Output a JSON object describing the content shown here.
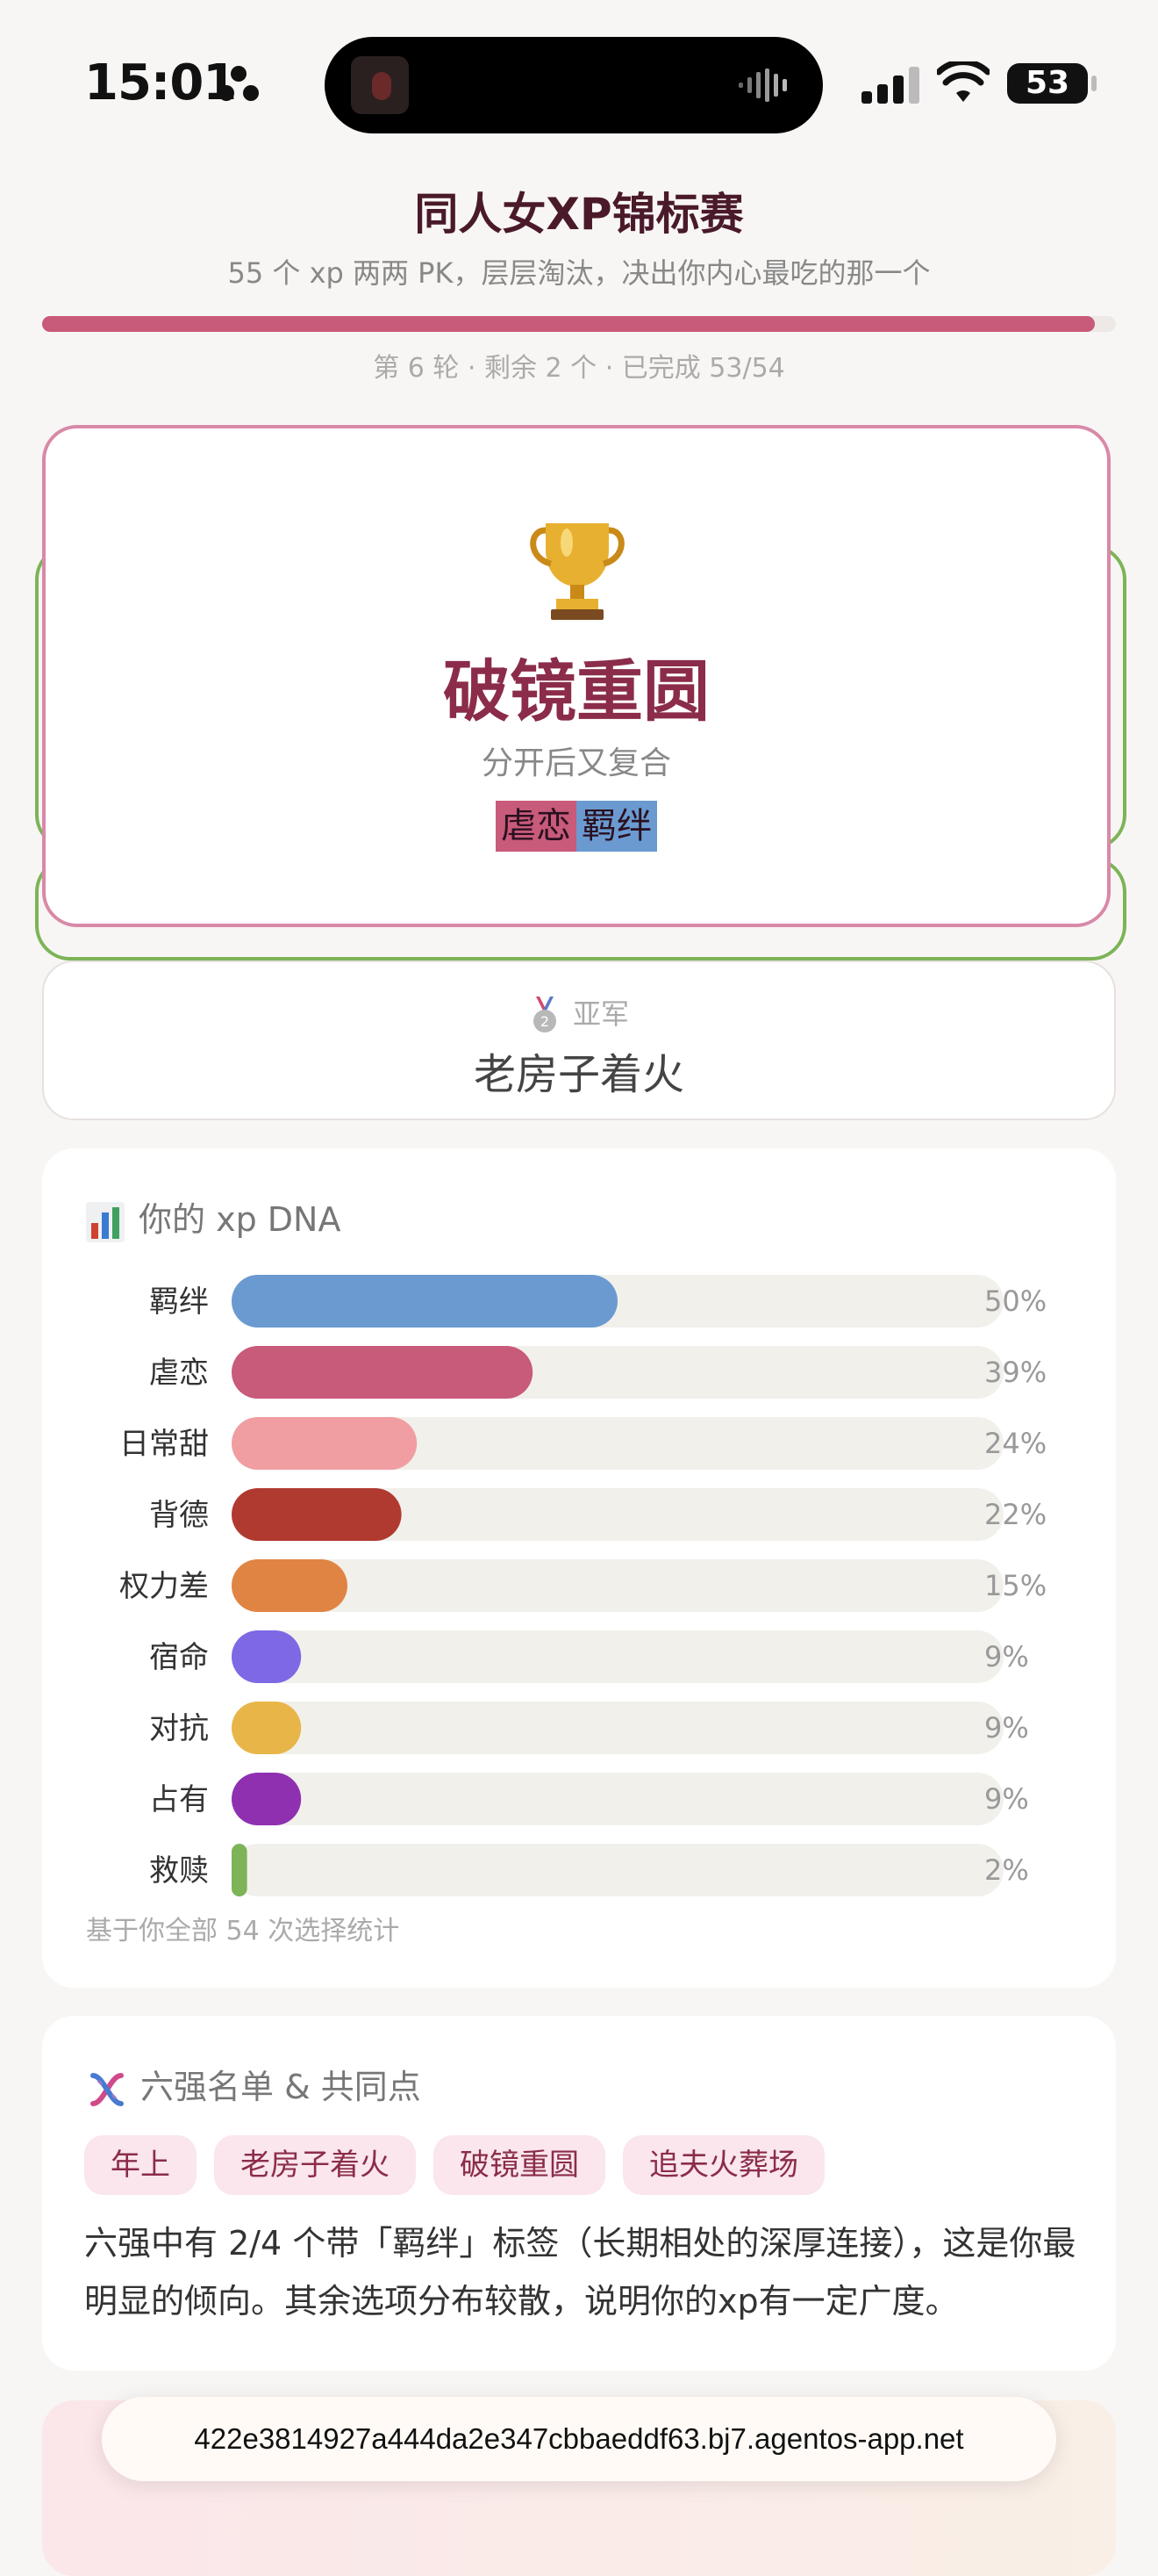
{
  "status_bar": {
    "time": "15:01",
    "battery": "53"
  },
  "header": {
    "title": "同人女XP锦标赛",
    "subtitle": "55 个 xp 两两 PK，层层淘汰，决出你内心最吃的那一个",
    "progress": 0.98,
    "round_info": "第 6 轮 · 剩余 2 个 · 已完成 53/54"
  },
  "champion": {
    "icon": "trophy-icon",
    "name": "破镜重圆",
    "description": "分开后又复合",
    "tags": [
      {
        "label": "虐恋",
        "color": "#c85a7a"
      },
      {
        "label": "羁绊",
        "color": "#6a9ad0"
      }
    ]
  },
  "runner_up": {
    "icon": "silver-medal-icon",
    "label": "亚军",
    "name": "老房子着火"
  },
  "dna": {
    "heading": "你的 xp DNA",
    "footnote": "基于你全部 54 次选择统计",
    "chart_data": {
      "type": "bar",
      "orientation": "horizontal",
      "categories": [
        "羁绊",
        "虐恋",
        "日常甜",
        "背德",
        "权力差",
        "宿命",
        "对抗",
        "占有",
        "救赎"
      ],
      "values": [
        50,
        39,
        24,
        22,
        15,
        9,
        9,
        9,
        2
      ],
      "value_labels": [
        "50%",
        "39%",
        "24%",
        "22%",
        "15%",
        "9%",
        "9%",
        "9%",
        "2%"
      ],
      "colors": [
        "#6a9ad0",
        "#c85a7a",
        "#f09ea2",
        "#b03a30",
        "#e08444",
        "#7f68e4",
        "#e8b648",
        "#8e30b0",
        "#7cb457"
      ],
      "xlim": [
        0,
        100
      ]
    }
  },
  "top_six": {
    "heading": "六强名单 & 共同点",
    "tags": [
      "年上",
      "老房子着火",
      "破镜重圆",
      "追夫火葬场"
    ],
    "summary": "六强中有 2/4 个带「羁绊」标签（长期相处的深厚连接），这是你最明显的倾向。其余选项分布较散，说明你的xp有一定广度。"
  },
  "footer": {
    "url": "422e3814927a444da2e347cbbaeddf63.bj7.agentos-app.net"
  }
}
